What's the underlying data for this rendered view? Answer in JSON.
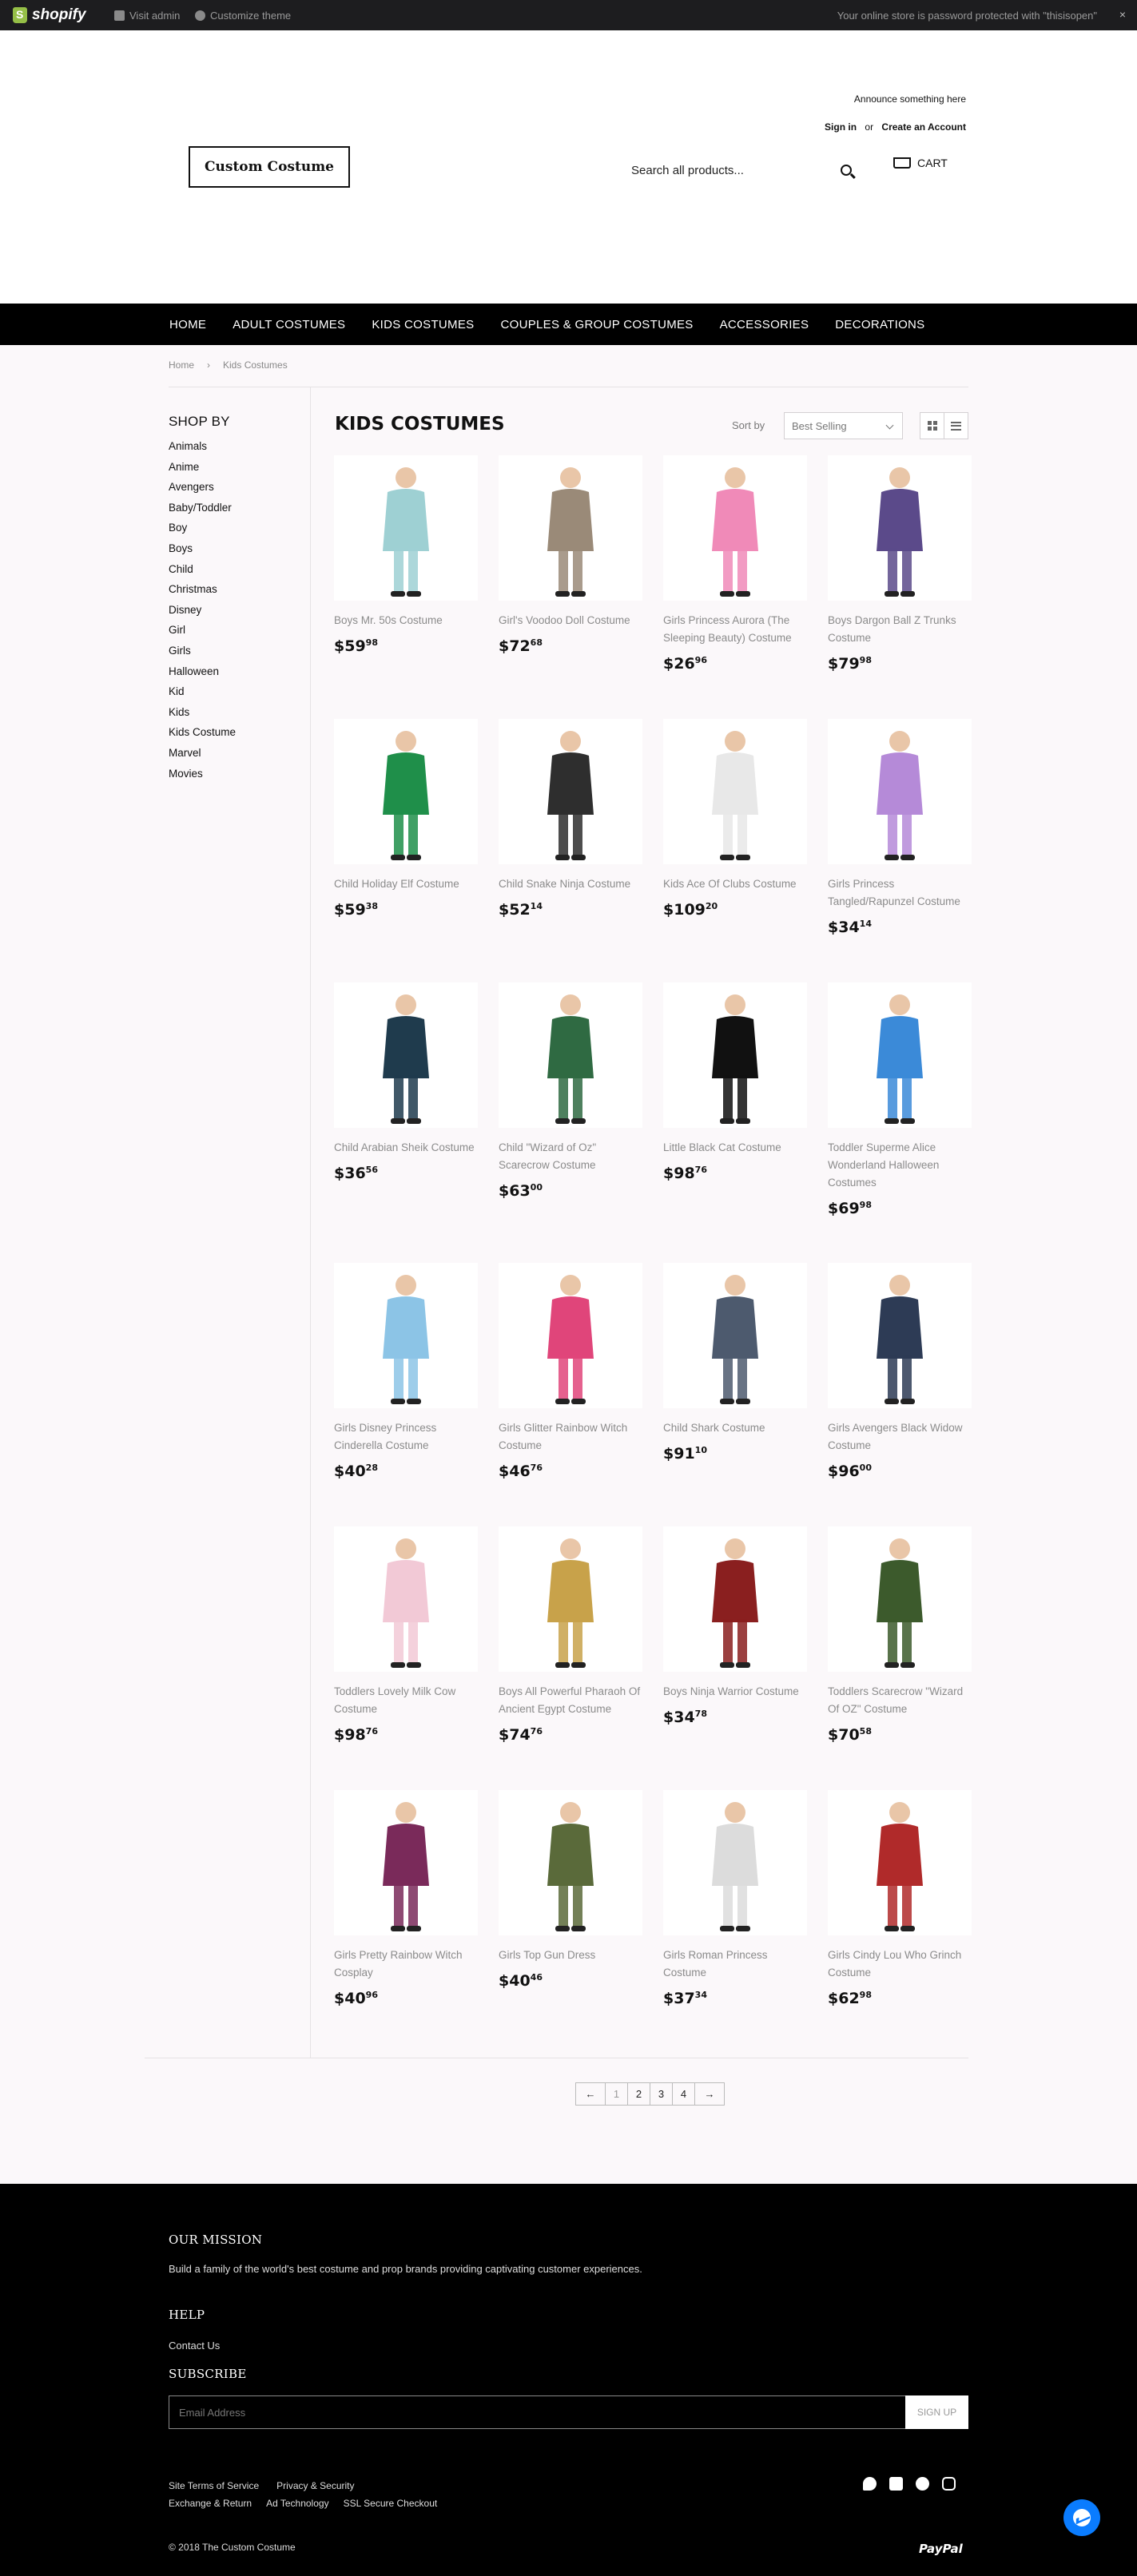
{
  "admin_bar": {
    "brand": "shopify",
    "visit_admin": "Visit admin",
    "customize_theme": "Customize theme",
    "password_notice": "Your online store is password protected with \"thisisopen\"",
    "close": "×"
  },
  "header": {
    "logo_text": "Custom Costume",
    "announcement": "Announce something here",
    "sign_in": "Sign in",
    "or": "or",
    "create_account": "Create an Account",
    "search_placeholder": "Search all products...",
    "cart_label": "CART"
  },
  "nav": [
    "HOME",
    "ADULT COSTUMES",
    "KIDS COSTUMES",
    "COUPLES & GROUP COSTUMES",
    "ACCESSORIES",
    "DECORATIONS"
  ],
  "breadcrumb": {
    "home": "Home",
    "separator": "›",
    "current": "Kids Costumes"
  },
  "sidebar": {
    "heading": "SHOP BY",
    "tags": [
      "Animals",
      "Anime",
      "Avengers",
      "Baby/Toddler",
      "Boy",
      "Boys",
      "Child",
      "Christmas",
      "Disney",
      "Girl",
      "Girls",
      "Halloween",
      "Kid",
      "Kids",
      "Kids Costume",
      "Marvel",
      "Movies"
    ]
  },
  "collection": {
    "title": "KIDS COSTUMES",
    "sort_label": "Sort by",
    "sort_value": "Best Selling"
  },
  "products": [
    {
      "title": "Boys Mr. 50s Costume",
      "price_main": "$59",
      "price_cents": "98",
      "color": "#9ed0d3"
    },
    {
      "title": "Girl's Voodoo Doll Costume",
      "price_main": "$72",
      "price_cents": "68",
      "color": "#9a8a78"
    },
    {
      "title": "Girls Princess Aurora (The Sleeping Beauty) Costume",
      "price_main": "$26",
      "price_cents": "96",
      "color": "#f08ab8"
    },
    {
      "title": "Boys Dargon Ball Z Trunks Costume",
      "price_main": "$79",
      "price_cents": "98",
      "color": "#5b4a8a"
    },
    {
      "title": "Child Holiday Elf Costume",
      "price_main": "$59",
      "price_cents": "38",
      "color": "#1f8f4a"
    },
    {
      "title": "Child Snake Ninja Costume",
      "price_main": "$52",
      "price_cents": "14",
      "color": "#2e2e2e"
    },
    {
      "title": "Kids Ace Of Clubs Costume",
      "price_main": "$109",
      "price_cents": "20",
      "color": "#e8e8e8"
    },
    {
      "title": "Girls Princess Tangled/Rapunzel Costume",
      "price_main": "$34",
      "price_cents": "14",
      "color": "#b58ad8"
    },
    {
      "title": "Child Arabian Sheik Costume",
      "price_main": "$36",
      "price_cents": "56",
      "color": "#1f3b4d"
    },
    {
      "title": "Child \"Wizard of Oz\" Scarecrow Costume",
      "price_main": "$63",
      "price_cents": "00",
      "color": "#2f6a42"
    },
    {
      "title": "Little Black Cat Costume",
      "price_main": "$98",
      "price_cents": "76",
      "color": "#111111"
    },
    {
      "title": "Toddler Superme Alice Wonderland Halloween Costumes",
      "price_main": "$69",
      "price_cents": "98",
      "color": "#3b8ad8"
    },
    {
      "title": "Girls Disney Princess Cinderella Costume",
      "price_main": "$40",
      "price_cents": "28",
      "color": "#8cc4e6"
    },
    {
      "title": "Girls Glitter Rainbow Witch Costume",
      "price_main": "$46",
      "price_cents": "76",
      "color": "#e0457a"
    },
    {
      "title": "Child Shark Costume",
      "price_main": "$91",
      "price_cents": "10",
      "color": "#4d5a6e"
    },
    {
      "title": "Girls Avengers Black Widow Costume",
      "price_main": "$96",
      "price_cents": "00",
      "color": "#2d3b55"
    },
    {
      "title": "Toddlers Lovely Milk Cow Costume",
      "price_main": "$98",
      "price_cents": "76",
      "color": "#f2c9d6"
    },
    {
      "title": "Boys All Powerful Pharaoh Of Ancient Egypt Costume",
      "price_main": "$74",
      "price_cents": "76",
      "color": "#c8a24a"
    },
    {
      "title": "Boys Ninja Warrior Costume",
      "price_main": "$34",
      "price_cents": "78",
      "color": "#8a1f1f"
    },
    {
      "title": "Toddlers Scarecrow \"Wizard Of OZ\" Costume",
      "price_main": "$70",
      "price_cents": "58",
      "color": "#3c5a2c"
    },
    {
      "title": "Girls Pretty Rainbow Witch Cosplay",
      "price_main": "$40",
      "price_cents": "96",
      "color": "#7a2a5a"
    },
    {
      "title": "Girls Top Gun Dress",
      "price_main": "$40",
      "price_cents": "46",
      "color": "#5a6a3a"
    },
    {
      "title": "Girls Roman Princess Costume",
      "price_main": "$37",
      "price_cents": "34",
      "color": "#dcdcdc"
    },
    {
      "title": "Girls Cindy Lou Who Grinch Costume",
      "price_main": "$62",
      "price_cents": "98",
      "color": "#b02a2a"
    }
  ],
  "pagination": {
    "prev": "←",
    "pages": [
      "1",
      "2",
      "3",
      "4"
    ],
    "next": "→"
  },
  "footer": {
    "mission_heading": "OUR MISSION",
    "mission_text": "Build a family of the world's best costume and prop brands providing captivating customer experiences.",
    "help_heading": "HELP",
    "contact": "Contact Us",
    "subscribe_heading": "SUBSCRIBE",
    "email_placeholder": "Email Address",
    "signup": "SIGN UP",
    "links_row1": [
      "Site Terms of Service",
      "Privacy & Security"
    ],
    "links_row2": [
      "Exchange & Return",
      "Ad Technology",
      "SSL Secure Checkout"
    ],
    "copyright": "© 2018 The Custom Costume",
    "paypal": "PayPal",
    "social_icons": [
      "twitter-icon",
      "facebook-icon",
      "pinterest-icon",
      "instagram-icon"
    ]
  }
}
